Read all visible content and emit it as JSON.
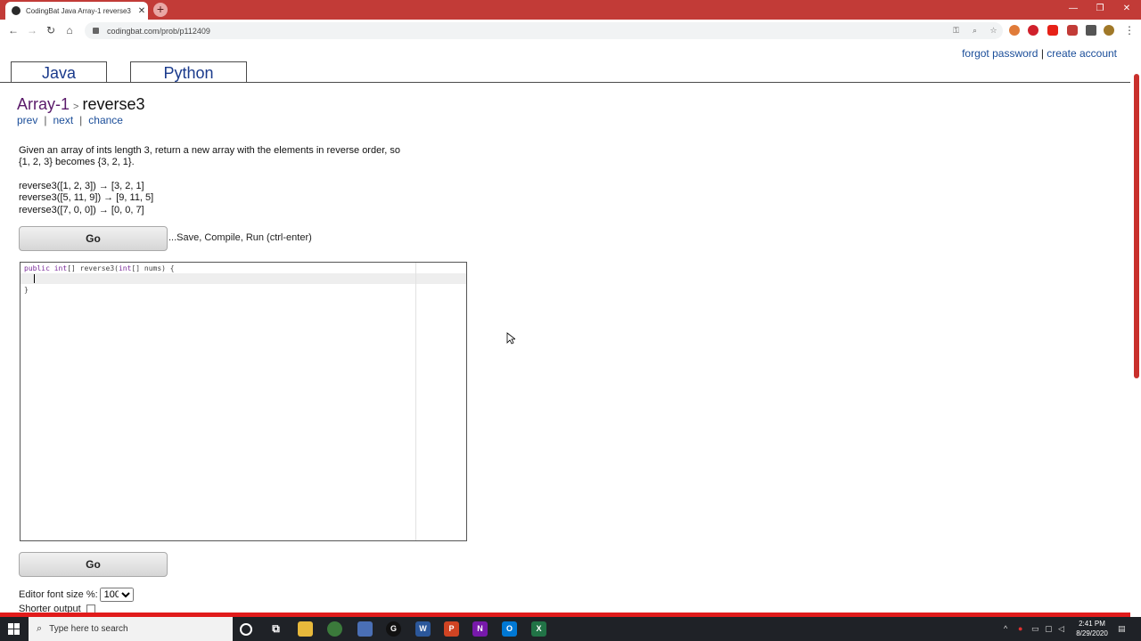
{
  "browser": {
    "tab_title": "CodingBat Java Array-1 reverse3",
    "tab_close": "✕",
    "new_tab": "+",
    "url": "codingbat.com/prob/p112409",
    "window_controls": {
      "minimize": "—",
      "restore": "❐",
      "close": "✕"
    },
    "nav": {
      "back": "←",
      "forward": "→",
      "reload": "↻",
      "home": "⌂"
    }
  },
  "account": {
    "forgot_password": "forgot password",
    "separator": "|",
    "create_account": "create account"
  },
  "tabs": [
    {
      "label": "Java"
    },
    {
      "label": "Python"
    }
  ],
  "breadcrumb": {
    "section": "Array-1",
    "separator": ">",
    "problem": "reverse3"
  },
  "problem_nav": {
    "prev": "prev",
    "next": "next",
    "chance": "chance",
    "separator": "|"
  },
  "description": {
    "line1": "Given an array of ints length 3, return a new array with the elements in reverse order, so",
    "line2": "{1, 2, 3} becomes {3, 2, 1}."
  },
  "examples": [
    "reverse3([1, 2, 3]) → [3, 2, 1]",
    "reverse3([5, 11, 9]) → [9, 11, 5]",
    "reverse3([7, 0, 0]) → [0, 0, 7]"
  ],
  "go_button": {
    "label": "Go"
  },
  "go_hint": "...Save, Compile, Run (ctrl-enter)",
  "editor": {
    "line1_kw1": "public",
    "line1_type": "int",
    "line1_rest": "[] reverse3(",
    "line1_type2": "int",
    "line1_rest2": "[] nums) {",
    "line3": "}"
  },
  "settings": {
    "font_size_label": "Editor font size %:",
    "font_size_value": "100",
    "shorter_output_label": "Shorter output"
  },
  "taskbar": {
    "search_placeholder": "Type here to search",
    "time": "2:41 PM",
    "date": "8/29/2020"
  }
}
